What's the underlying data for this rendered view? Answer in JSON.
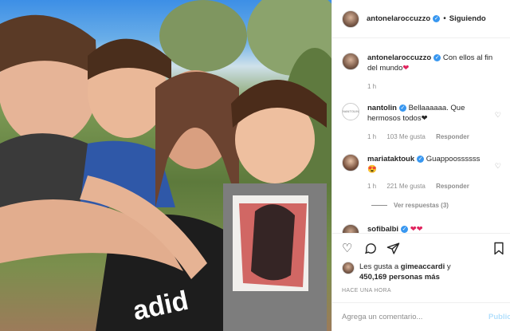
{
  "post": {
    "author": "antonelaroccuzzo",
    "follow_status": "Siguiendo",
    "caption_user": "antonelaroccuzzo",
    "caption_text": "Con ellos al fin del mundo",
    "caption_emoji": "❤",
    "caption_time": "1 h"
  },
  "photo": {
    "shirt_text": "adid"
  },
  "comments": [
    {
      "user": "nantolin",
      "text": "Bellaaaaaa. Que hermosos todos❤",
      "time": "1 h",
      "likes": "103 Me gusta",
      "reply": "Responder",
      "avatar_text": "NANTOLIN"
    },
    {
      "user": "mariataktouk",
      "text": "Guappoossssss",
      "emoji": "😍",
      "time": "1 h",
      "likes": "221 Me gusta",
      "reply": "Responder",
      "view_replies": "Ver respuestas (3)"
    },
    {
      "user": "sofibalbi",
      "emoji": "❤❤"
    }
  ],
  "likes": {
    "prefix": "Les gusta a",
    "user": "gimeaccardi",
    "mid": "y",
    "count": "450,169",
    "suffix": "personas más"
  },
  "posted": "HACE UNA HORA",
  "add_comment": {
    "placeholder": "Agrega un comentario...",
    "publish": "Publicar"
  }
}
